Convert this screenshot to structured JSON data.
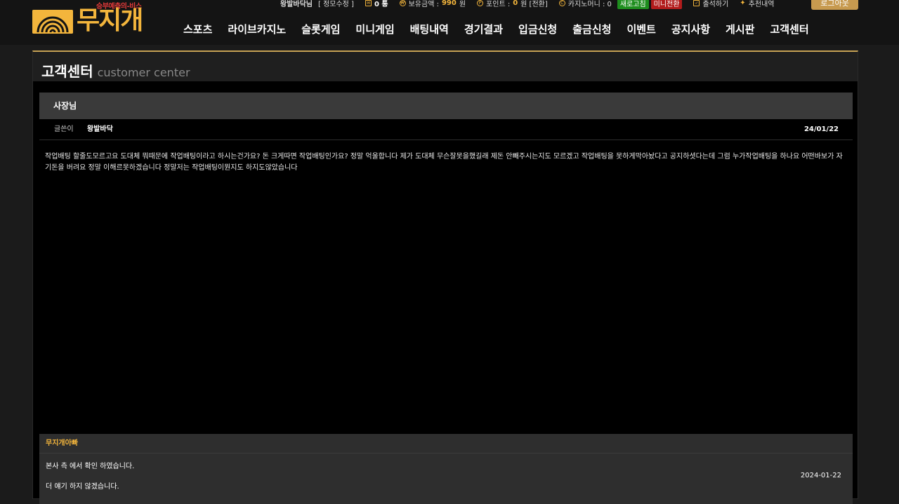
{
  "logo": {
    "tagline": "승부예측의-비스",
    "name": "무지개"
  },
  "topbar": {
    "user": "왕발바닥님",
    "level": "[ 정모수정 ]",
    "messages": "0 통",
    "balance_label": "보유금액 :",
    "balance": "990",
    "balance_unit": "원",
    "points_label": "포인트 :",
    "points": "0",
    "points_unit": "원 [전환]",
    "casino_money": "카지노머니 : 0",
    "refresh": "새로고침",
    "mini_switch": "미니전환",
    "attendance": "출석하기",
    "recommend": "추천내역",
    "logout": "로그아웃"
  },
  "nav": [
    "스포츠",
    "라이브카지노",
    "슬롯게임",
    "미니게임",
    "배팅내역",
    "경기결과",
    "입금신청",
    "출금신청",
    "이벤트",
    "공지사항",
    "게시판",
    "고객센터"
  ],
  "page": {
    "title": "고객센터",
    "subtitle": "customer center"
  },
  "post": {
    "title": "사장님",
    "author_label": "글쓴이",
    "author": "왕발바닥",
    "date": "24/01/22",
    "body": "작업배팅 할줄도모르고요 도대체 뭐때문에 작업배팅이라고 하시는건가요? 돈 크게따면 작업배팅인가요? 정말 억울합니다 제가 도대체 무슨잘못을했길래 제돈 안빼주시는지도 모르겠고 작업배팅을 못하게막아놨다고 공지하셧다는데 그럼 누가작업배팅을 하나요 어떤바보가 자기돈을 버려요 정말 이해르못하겠습니다 정말저는 작업배팅이뭔지도 하지도않았습니다"
  },
  "reply": {
    "author": "무지개아빠",
    "line1": "본사 측 에서 확인 하였습니다.",
    "line2": "더 얘기 하지 않겠습니다.",
    "date": "2024-01-22"
  }
}
